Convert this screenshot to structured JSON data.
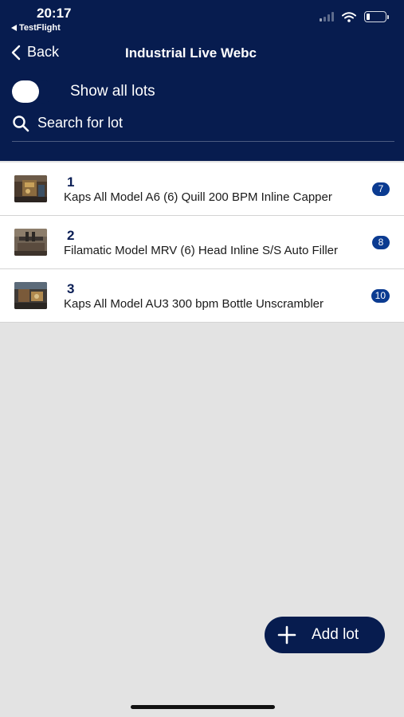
{
  "status_bar": {
    "time": "20:17",
    "back_app": "TestFlight",
    "back_arrow_icon": "back-triangle-icon",
    "signal_icon": "cellular-signal-icon",
    "wifi_icon": "wifi-icon",
    "battery_icon": "battery-icon",
    "battery_level": 0.2
  },
  "nav": {
    "back_label": "Back",
    "back_icon": "chevron-left-icon",
    "title": "Industrial Live Webc"
  },
  "filters": {
    "show_all_lots_label": "Show all lots",
    "show_all_lots_on": false,
    "search_placeholder": "Search for lot",
    "search_icon": "search-icon"
  },
  "lots": [
    {
      "number": "1",
      "title": "Kaps All Model A6 (6) Quill 200 BPM Inline Capper",
      "badge": "7"
    },
    {
      "number": "2",
      "title": "Filamatic Model MRV (6) Head Inline S/S Auto Filler",
      "badge": "8"
    },
    {
      "number": "3",
      "title": "Kaps All Model AU3 300 bpm Bottle Unscrambler",
      "badge": "10"
    }
  ],
  "add_lot": {
    "label": "Add lot",
    "icon": "plus-icon"
  },
  "colors": {
    "header_bg": "#071c4f",
    "badge_bg": "#0b3b91",
    "list_bg": "#ffffff",
    "page_bg": "#e3e3e3"
  }
}
